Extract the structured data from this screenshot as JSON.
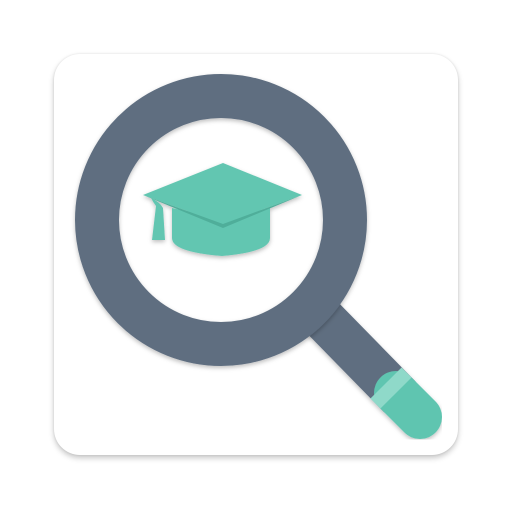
{
  "app_icon": {
    "name": "app-icon",
    "glyphs": [
      "magnifier-icon",
      "graduation-cap-icon"
    ],
    "colors": {
      "tile_background": "#ffffff",
      "magnifier_ring": "#5e6e80",
      "handle_tip": "#5fc5b0",
      "handle_band": "#8fd9c9",
      "cap": "#62c6b1",
      "cap_shade": "#4fae9a"
    }
  }
}
